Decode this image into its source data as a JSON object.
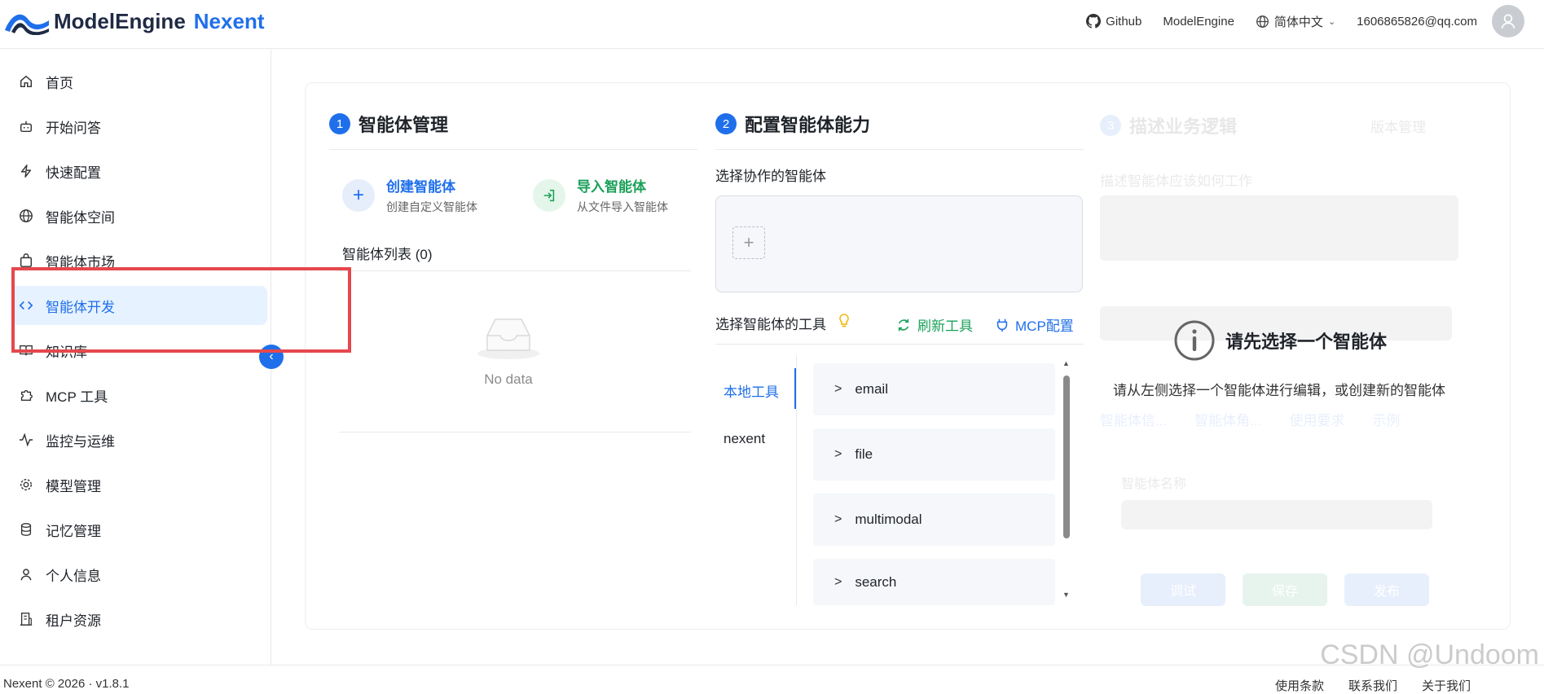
{
  "header": {
    "brand": "ModelEngine",
    "brand_accent": "Nexent",
    "github": "Github",
    "modelengine": "ModelEngine",
    "language": "简体中文",
    "user_email": "1606865826@qq.com"
  },
  "sidebar": {
    "items": [
      {
        "label": "首页",
        "icon": "home-icon"
      },
      {
        "label": "开始问答",
        "icon": "bot-icon"
      },
      {
        "label": "快速配置",
        "icon": "bolt-icon"
      },
      {
        "label": "智能体空间",
        "icon": "globe-icon"
      },
      {
        "label": "智能体市场",
        "icon": "bag-icon"
      },
      {
        "label": "智能体开发",
        "icon": "code-icon"
      },
      {
        "label": "知识库",
        "icon": "book-icon"
      },
      {
        "label": "MCP 工具",
        "icon": "puzzle-icon"
      },
      {
        "label": "监控与运维",
        "icon": "pulse-icon"
      },
      {
        "label": "模型管理",
        "icon": "gear-icon"
      },
      {
        "label": "记忆管理",
        "icon": "database-icon"
      },
      {
        "label": "个人信息",
        "icon": "user-icon"
      },
      {
        "label": "租户资源",
        "icon": "building-icon"
      }
    ],
    "active_label": "智能体开发"
  },
  "section1": {
    "number": "1",
    "title": "智能体管理",
    "create_title": "创建智能体",
    "create_sub": "创建自定义智能体",
    "import_title": "导入智能体",
    "import_sub": "从文件导入智能体",
    "list_label": "智能体列表 (0)",
    "empty_text": "No data"
  },
  "section2": {
    "number": "2",
    "title": "配置智能体能力",
    "collab_label": "选择协作的智能体",
    "tools_label": "选择智能体的工具",
    "refresh_tools": "刷新工具",
    "mcp_config": "MCP配置",
    "tabs": [
      "本地工具",
      "nexent"
    ],
    "groups": [
      "email",
      "file",
      "multimodal",
      "search"
    ]
  },
  "section3": {
    "number": "3",
    "title": "描述业务逻辑",
    "version_mgmt": "版本管理",
    "desc_label": "描述智能体应该如何工作",
    "overlay_title": "请先选择一个智能体",
    "overlay_sub": "请从左侧选择一个智能体进行编辑，或创建新的智能体",
    "tabs": [
      "智能体信...",
      "智能体角...",
      "使用要求",
      "示例"
    ],
    "name_label": "智能体名称",
    "btn_debug": "调试",
    "btn_save": "保存",
    "btn_publish": "发布"
  },
  "footer": {
    "copyright": "Nexent © 2026 · v1.8.1",
    "links": [
      "使用条款",
      "联系我们",
      "关于我们"
    ]
  },
  "watermark": "CSDN @Undoom",
  "colors": {
    "accent": "#1f6feb",
    "green": "#1aa05a",
    "highlight": "#e5484d"
  }
}
